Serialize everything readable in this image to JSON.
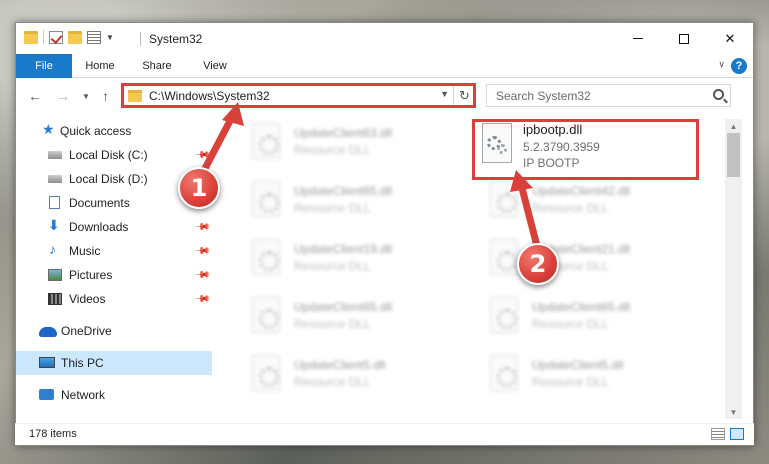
{
  "window": {
    "title": "System32"
  },
  "ribbon": {
    "tabs": [
      "File",
      "Home",
      "Share",
      "View"
    ],
    "help": "?"
  },
  "address": {
    "path": "C:\\Windows\\System32",
    "search_placeholder": "Search System32"
  },
  "sidebar": {
    "items": [
      {
        "label": "Quick access",
        "icon": "star-icon",
        "pinned": false
      },
      {
        "label": "Local Disk (C:)",
        "icon": "drive-icon",
        "pinned": true
      },
      {
        "label": "Local Disk (D:)",
        "icon": "drive-icon",
        "pinned": false
      },
      {
        "label": "Documents",
        "icon": "documents-icon",
        "pinned": true
      },
      {
        "label": "Downloads",
        "icon": "downloads-icon",
        "pinned": true
      },
      {
        "label": "Music",
        "icon": "music-icon",
        "pinned": true
      },
      {
        "label": "Pictures",
        "icon": "pictures-icon",
        "pinned": true
      },
      {
        "label": "Videos",
        "icon": "videos-icon",
        "pinned": true
      },
      {
        "label": "OneDrive",
        "icon": "onedrive-icon",
        "pinned": false
      },
      {
        "label": "This PC",
        "icon": "this-pc-icon",
        "pinned": false,
        "selected": true
      },
      {
        "label": "Network",
        "icon": "network-icon",
        "pinned": false
      }
    ]
  },
  "files": [
    {
      "name": "UpdateClient63.dll",
      "type": "Resource DLL"
    },
    {
      "name": "UpdateClient65.dll",
      "type": "Resource DLL"
    },
    {
      "name": "UpdateClient42.dll",
      "type": "Resource DLL"
    },
    {
      "name": "UpdateClient19.dll",
      "type": "Resource DLL"
    },
    {
      "name": "UpdateClient21.dll",
      "type": "Resource DLL"
    },
    {
      "name": "UpdateClient65.dll",
      "type": "Resource DLL"
    },
    {
      "name": "UpdateClient65.dll",
      "type": "Resource DLL"
    },
    {
      "name": "UpdateClient5.dll",
      "type": "Resource DLL"
    },
    {
      "name": "UpdateClient5.dll",
      "type": "Resource DLL"
    }
  ],
  "target_file": {
    "name": "ipbootp.dll",
    "version": "5.2.3790.3959",
    "description": "IP BOOTP"
  },
  "status": {
    "item_count": "178 items"
  },
  "callouts": {
    "one": "1",
    "two": "2"
  },
  "colors": {
    "accent": "#1979ca",
    "highlight": "#d9403a",
    "selection": "#cce8ff"
  }
}
